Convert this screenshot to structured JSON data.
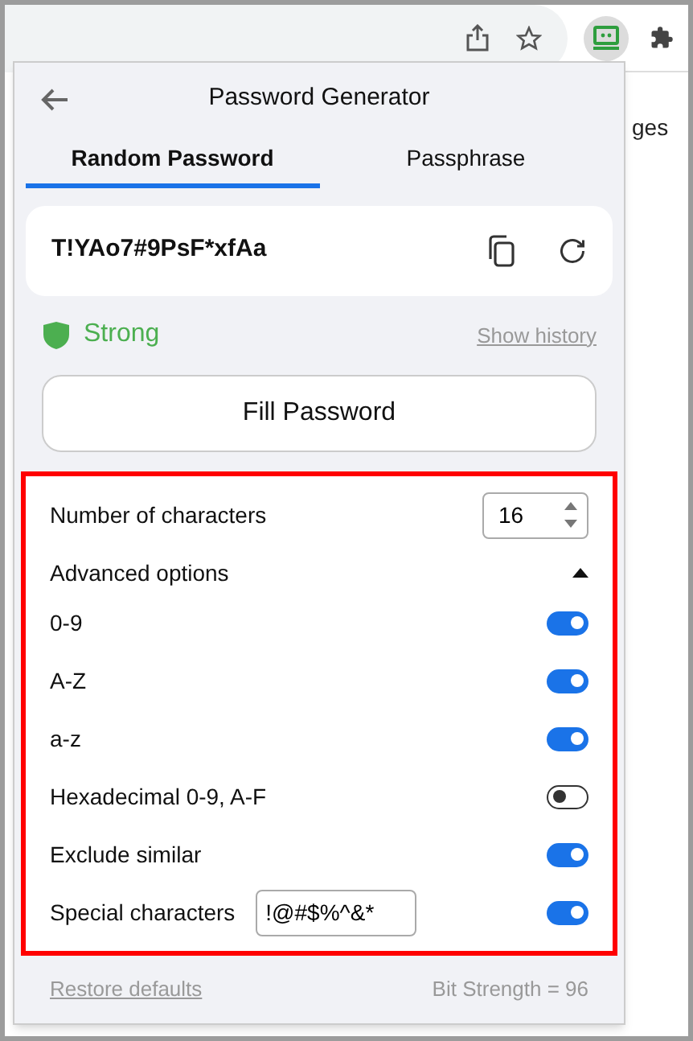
{
  "background_text": "ges",
  "popup": {
    "title": "Password Generator",
    "tabs": [
      {
        "label": "Random Password",
        "selected": true
      },
      {
        "label": "Passphrase",
        "selected": false
      }
    ],
    "password": "T!YAo7#9PsF*xfAa",
    "strength": "Strong",
    "show_history": "Show history",
    "fill_button": "Fill Password",
    "options": [
      {
        "kind": "number",
        "label": "Number of characters",
        "value": "16"
      },
      {
        "kind": "section",
        "label": "Advanced options",
        "expanded": true
      },
      {
        "kind": "toggle",
        "label": "0-9",
        "on": true
      },
      {
        "kind": "toggle",
        "label": "A-Z",
        "on": true
      },
      {
        "kind": "toggle",
        "label": "a-z",
        "on": true
      },
      {
        "kind": "toggle",
        "label": "Hexadecimal 0-9, A-F",
        "on": false
      },
      {
        "kind": "toggle",
        "label": "Exclude similar",
        "on": true
      },
      {
        "kind": "toggle_text",
        "label": "Special characters",
        "value": "!@#$%^&*",
        "on": true
      }
    ],
    "restore_defaults": "Restore defaults",
    "bit_strength": "Bit Strength = 96"
  }
}
